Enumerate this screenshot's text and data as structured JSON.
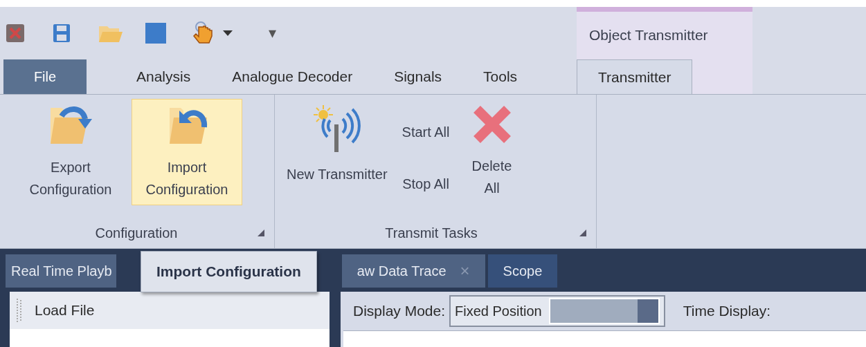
{
  "quick_access": {
    "customize": "▾"
  },
  "contextual_group": {
    "title": "Object Transmitter"
  },
  "tabs": [
    {
      "label": "File",
      "kind": "backstage",
      "selected": false
    },
    {
      "label": "Analysis",
      "kind": "tab",
      "selected": false
    },
    {
      "label": "Analogue Decoder",
      "kind": "tab",
      "selected": false
    },
    {
      "label": "Signals",
      "kind": "tab",
      "selected": false
    },
    {
      "label": "Tools",
      "kind": "tab",
      "selected": false
    },
    {
      "label": "Transmitter",
      "kind": "tab",
      "selected": true
    }
  ],
  "ribbon_groups": [
    {
      "title": "Configuration",
      "buttons": [
        {
          "label": "Export Configuration",
          "kind": "export",
          "highlighted": false
        },
        {
          "label": "Import Configuration",
          "kind": "import",
          "highlighted": true
        }
      ]
    },
    {
      "title": "Transmit Tasks",
      "buttons": [
        {
          "label": "New Transmitter",
          "kind": "transmitter",
          "highlighted": false
        },
        {
          "label": "Start All",
          "kind": "small",
          "highlighted": false
        },
        {
          "label": "Stop All",
          "kind": "small",
          "highlighted": false
        },
        {
          "label": "Delete All",
          "kind": "delete",
          "highlighted": false
        }
      ]
    }
  ],
  "tooltip": {
    "text": "Import Configuration"
  },
  "document_tabs": [
    {
      "label": "Real Time Playb",
      "selected": false
    },
    {
      "label": "aw Data Trace",
      "close": "×",
      "selected": false
    },
    {
      "label": "Scope",
      "selected": true
    }
  ],
  "left_panel": {
    "title": "Load File"
  },
  "scope_toolbar": {
    "display_mode_label": "Display Mode:",
    "display_mode_value": "Fixed Position",
    "time_display_label": "Time Display:"
  }
}
